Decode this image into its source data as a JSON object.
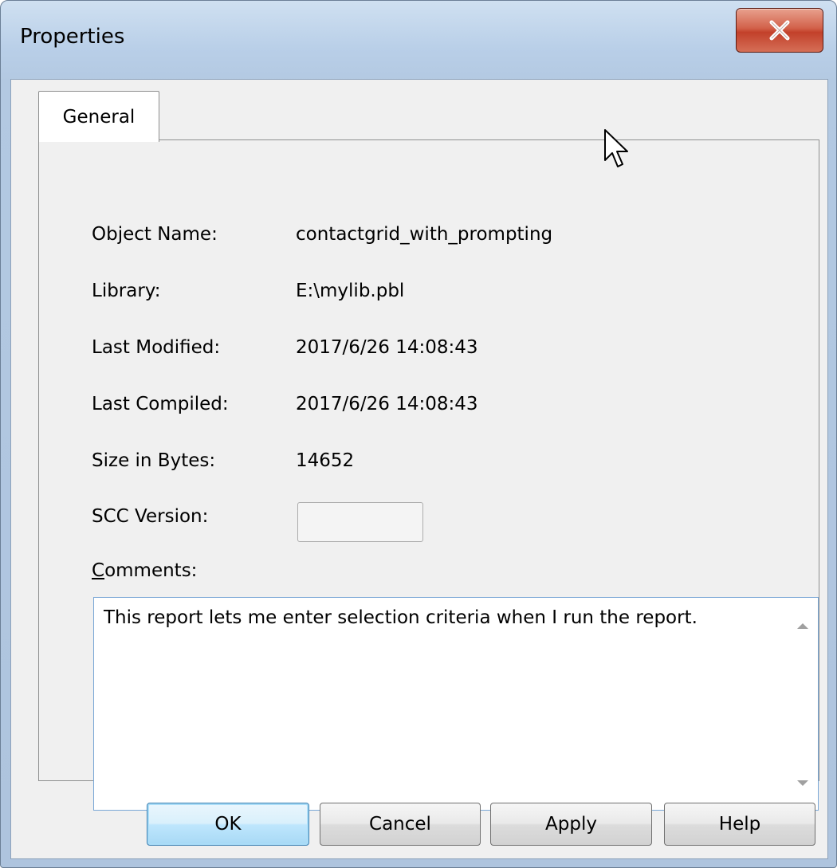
{
  "window": {
    "title": "Properties",
    "close_symbol": "x"
  },
  "tabs": [
    {
      "label": "General",
      "selected": true
    }
  ],
  "properties": [
    {
      "label": "Object Name:",
      "value": "contactgrid_with_prompting"
    },
    {
      "label": "Library:",
      "value": "E:\\mylib.pbl"
    },
    {
      "label": "Last Modified:",
      "value": "2017/6/26 14:08:43"
    },
    {
      "label": "Last Compiled:",
      "value": "2017/6/26 14:08:43"
    },
    {
      "label": "Size in Bytes:",
      "value": "14652"
    }
  ],
  "scc": {
    "label": "SCC Version:",
    "value": ""
  },
  "comments": {
    "label_first": "C",
    "label_rest": "omments:",
    "value": "This report lets me enter selection criteria when I run the report."
  },
  "buttons": {
    "ok": "OK",
    "cancel": "Cancel",
    "apply": "Apply",
    "help": "Help"
  },
  "colors": {
    "title_bar": "#b9cfe8",
    "close_button": "#c2402a",
    "dialog_bg": "#f0f0f0",
    "default_button": "#bee6fd"
  }
}
